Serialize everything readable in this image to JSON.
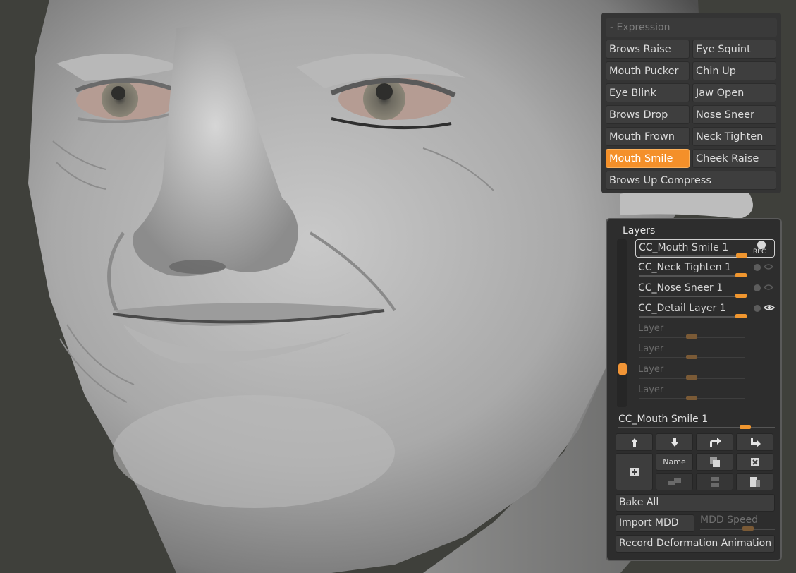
{
  "expression": {
    "header": "- Expression",
    "buttons": [
      {
        "label": "Brows Raise",
        "active": false
      },
      {
        "label": "Eye Squint",
        "active": false
      },
      {
        "label": "Mouth Pucker",
        "active": false
      },
      {
        "label": "Chin Up",
        "active": false
      },
      {
        "label": "Eye Blink",
        "active": false
      },
      {
        "label": "Jaw Open",
        "active": false
      },
      {
        "label": "Brows Drop",
        "active": false
      },
      {
        "label": "Nose Sneer",
        "active": false
      },
      {
        "label": "Mouth Frown",
        "active": false
      },
      {
        "label": "Neck Tighten",
        "active": false
      },
      {
        "label": "Mouth Smile",
        "active": true
      },
      {
        "label": "Cheek Raise",
        "active": false
      }
    ],
    "wide_button": "Brows Up Compress"
  },
  "layers": {
    "title": "Layers",
    "rows": [
      {
        "name": "CC_Mouth Smile 1",
        "indicator": "REC",
        "selected": true,
        "intensity": 0.82
      },
      {
        "name": "CC_Neck Tighten 1",
        "indicator": "eye-dim",
        "intensity": 0.82
      },
      {
        "name": "CC_Nose Sneer 1",
        "indicator": "eye-dim",
        "intensity": 0.82
      },
      {
        "name": "CC_Detail Layer 1",
        "indicator": "eye-on",
        "intensity": 0.82
      },
      {
        "name": "Layer",
        "empty": true,
        "intensity": 0.5
      },
      {
        "name": "Layer",
        "empty": true,
        "intensity": 0.5
      },
      {
        "name": "Layer",
        "empty": true,
        "intensity": 0.5
      },
      {
        "name": "Layer",
        "empty": true,
        "intensity": 0.5
      }
    ],
    "active_layer": "CC_Mouth Smile 1",
    "name_button": "Name",
    "bake_all": "Bake All",
    "import_mdd": "Import MDD",
    "mdd_speed": "MDD Speed",
    "record": "Record Deformation Animation"
  },
  "colors": {
    "accent": "#f4902a",
    "background": "#3f403b",
    "panel": "#2d2d2d"
  }
}
